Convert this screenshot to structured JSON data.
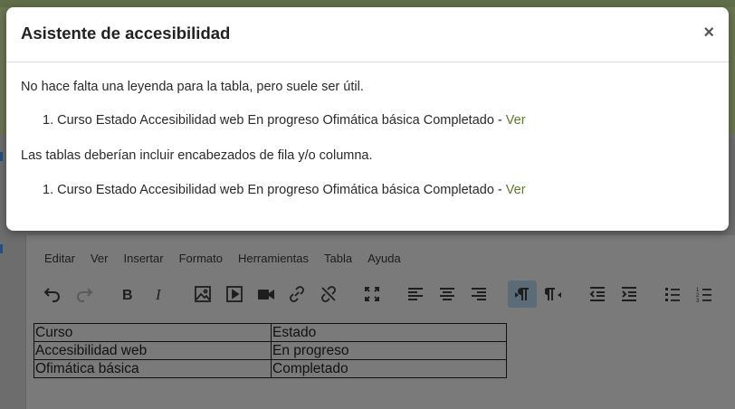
{
  "background": {
    "menu": [
      "Editar",
      "Ver",
      "Insertar",
      "Formato",
      "Herramientas",
      "Tabla",
      "Ayuda"
    ],
    "toolbar_icons": [
      "undo-icon",
      "redo-icon",
      "bold-icon",
      "italic-icon",
      "image-icon",
      "media-icon",
      "video-icon",
      "link-icon",
      "unlink-icon",
      "fullscreen-icon",
      "align-left-icon",
      "align-center-icon",
      "align-right-icon",
      "ltr-icon",
      "rtl-icon",
      "outdent-icon",
      "indent-icon",
      "bullet-list-icon",
      "numbered-list-icon"
    ],
    "table": {
      "rows": [
        [
          "Curso",
          "Estado"
        ],
        [
          "Accesibilidad web",
          "En progreso"
        ],
        [
          "Ofimática básica",
          "Completado"
        ]
      ]
    }
  },
  "modal": {
    "title": "Asistente de accesibilidad",
    "close_label": "×",
    "sections": [
      {
        "message": "No hace falta una leyenda para la tabla, pero suele ser útil.",
        "items": [
          {
            "number": "1.",
            "text": "Curso Estado Accesibilidad web En progreso Ofimática básica Completado - ",
            "link": "Ver"
          }
        ]
      },
      {
        "message": "Las tablas deberían incluir encabezados de fila y/o columna.",
        "items": [
          {
            "number": "1.",
            "text": "Curso Estado Accesibilidad web En progreso Ofimática básica Completado - ",
            "link": "Ver"
          }
        ]
      }
    ]
  },
  "colors": {
    "accent_link": "#5e7a2a",
    "overlay_gray": "#6d6d6d",
    "active_button": "#5b6b78"
  }
}
